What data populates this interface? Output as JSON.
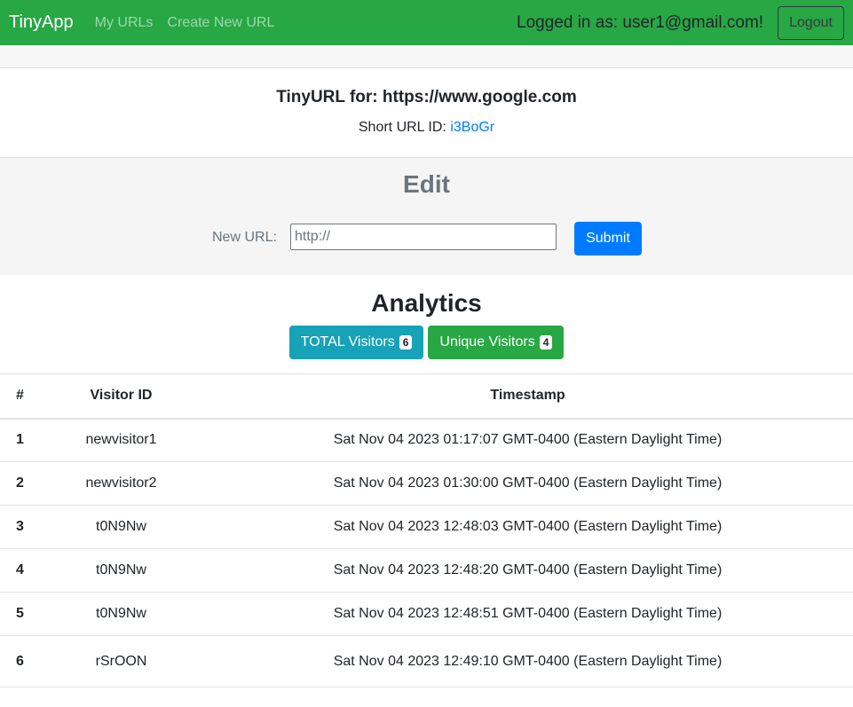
{
  "navbar": {
    "brand": "TinyApp",
    "links": [
      "My URLs",
      "Create New URL"
    ],
    "logged_in": "Logged in as: user1@gmail.com!",
    "logout_label": "Logout"
  },
  "url": {
    "title": "TinyURL for: https://www.google.com",
    "short_label": "Short URL ID:",
    "short_id": "i3BoGr"
  },
  "edit": {
    "title": "Edit",
    "label": "New URL:",
    "placeholder": "http://",
    "submit_label": "Submit"
  },
  "analytics": {
    "title": "Analytics",
    "total_label": "TOTAL Visitors",
    "total_count": "6",
    "unique_label": "Unique Visitors",
    "unique_count": "4"
  },
  "table": {
    "headers": [
      "#",
      "Visitor ID",
      "Timestamp"
    ],
    "rows": [
      [
        "1",
        "newvisitor1",
        "Sat Nov 04 2023 01:17:07 GMT-0400 (Eastern Daylight Time)"
      ],
      [
        "2",
        "newvisitor2",
        "Sat Nov 04 2023 01:30:00 GMT-0400 (Eastern Daylight Time)"
      ],
      [
        "3",
        "t0N9Nw",
        "Sat Nov 04 2023 12:48:03 GMT-0400 (Eastern Daylight Time)"
      ],
      [
        "4",
        "t0N9Nw",
        "Sat Nov 04 2023 12:48:20 GMT-0400 (Eastern Daylight Time)"
      ],
      [
        "5",
        "t0N9Nw",
        "Sat Nov 04 2023 12:48:51 GMT-0400 (Eastern Daylight Time)"
      ],
      [
        "6",
        "rSrOON",
        "Sat Nov 04 2023 12:49:10 GMT-0400 (Eastern Daylight Time)"
      ]
    ]
  },
  "colors": {
    "navbar": "#28a745",
    "primary": "#007bff",
    "info": "#17a2b8",
    "success": "#28a745"
  }
}
